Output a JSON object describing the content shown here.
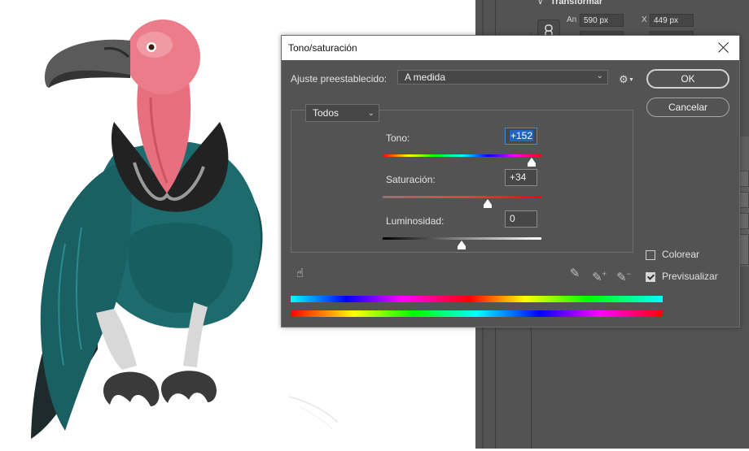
{
  "app": {
    "right_panel": {
      "section_title": "Transformar",
      "width_label": "An",
      "width_value": "590 px",
      "x_label": "X",
      "x_value": "449 px"
    }
  },
  "dialog": {
    "title": "Tono/saturación",
    "preset_label": "Ajuste preestablecido:",
    "preset_value": "A medida",
    "channel_value": "Todos",
    "ok_label": "OK",
    "cancel_label": "Cancelar",
    "tono_label": "Tono:",
    "tono_value": "+152",
    "saturacion_label": "Saturación:",
    "saturacion_value": "+34",
    "luminosidad_label": "Luminosidad:",
    "luminosidad_value": "0",
    "colorear_label": "Colorear",
    "colorear_checked": false,
    "previsualizar_label": "Previsualizar",
    "previsualizar_checked": true,
    "icons": [
      "hand-tool-icon",
      "eyedropper-icon",
      "eyedropper-plus-icon",
      "eyedropper-minus-icon",
      "gear-icon",
      "close-icon"
    ]
  },
  "colors": {
    "dialog_bg": "#535353",
    "selection_blue": "#1f66c4",
    "vulture_teal": "#1e6b6e",
    "vulture_pink": "#e8707e"
  }
}
